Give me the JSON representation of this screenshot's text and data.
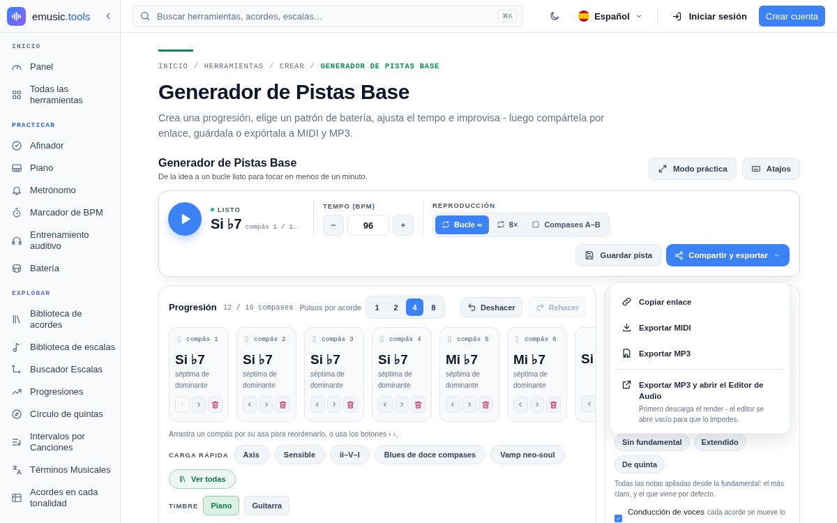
{
  "brand": {
    "name": "emusic",
    "accent": ".tools"
  },
  "search": {
    "placeholder": "Buscar herramientas, acordes, escalas…",
    "shortcut": "⌘K"
  },
  "header": {
    "language": "Español",
    "login": "Iniciar sesión",
    "signup": "Crear cuenta"
  },
  "sidebar": {
    "sections": [
      {
        "title": "INICIO",
        "color": "#64748b",
        "items": [
          {
            "label": "Panel"
          },
          {
            "label": "Todas las herramientas"
          }
        ]
      },
      {
        "title": "PRACTICAR",
        "color": "#2563eb",
        "items": [
          {
            "label": "Afinador"
          },
          {
            "label": "Piano"
          },
          {
            "label": "Metrónomo"
          },
          {
            "label": "Marcador de BPM"
          },
          {
            "label": "Entrenamiento auditivo"
          },
          {
            "label": "Batería"
          }
        ]
      },
      {
        "title": "EXPLORAR",
        "color": "#6366f1",
        "items": [
          {
            "label": "Biblioteca de acordes"
          },
          {
            "label": "Biblioteca de escalas"
          },
          {
            "label": "Buscador Escalas"
          },
          {
            "label": "Progresiones"
          },
          {
            "label": "Círculo de quintas"
          },
          {
            "label": "Intervalos por Canciones"
          },
          {
            "label": "Términos Musicales"
          },
          {
            "label": "Acordes en cada tonalidad"
          }
        ]
      }
    ]
  },
  "breadcrumbs": [
    {
      "label": "INICIO",
      "current": false
    },
    {
      "separator": "/",
      "label": "HERRAMIENTAS",
      "current": false
    },
    {
      "separator": "/",
      "label": "CREAR",
      "current": false
    },
    {
      "separator": "/",
      "label": "GENERADOR DE PISTAS BASE",
      "current": true
    }
  ],
  "title": "Generador de Pistas Base",
  "description": "Crea una progresión, elige un patrón de batería, ajusta el tempo e improvisa - luego compártela por enlace, guárdala o expórtala a MIDI y MP3.",
  "tool": {
    "title": "Generador de Pistas Base",
    "subtitle": "De la idea a un bucle listo para tocar en menos de un minuto.",
    "actions": [
      "Modo práctica",
      "Atajos"
    ]
  },
  "player": {
    "status": "LISTO",
    "chord": "Si ♭7",
    "position": "compás 1 / 1…",
    "tempo_label": "TEMPO (BPM)",
    "tempo": "96",
    "playback_label": "REPRODUCCIÓN",
    "modes": [
      {
        "label": "Bucle ∞",
        "selected": true
      },
      {
        "label": "8×",
        "selected": false
      },
      {
        "label": "Compases A–B",
        "selected": false
      }
    ],
    "save": "Guardar pista",
    "share": "Compartir y exportar"
  },
  "progression": {
    "title": "Progresión",
    "count": "12 / 16 compases",
    "beats_label": "Pulsos por acorde",
    "beats": [
      {
        "label": "1",
        "selected": false
      },
      {
        "label": "2",
        "selected": false
      },
      {
        "label": "4",
        "selected": true
      },
      {
        "label": "8",
        "selected": false
      }
    ],
    "undo": {
      "label": "Deshacer",
      "disabled": false
    },
    "redo": {
      "label": "Rehacer",
      "disabled": true
    },
    "bars": [
      {
        "label": "compás 1",
        "chord": "Si ♭7",
        "quality": "séptima de dominante",
        "prev_disabled": true
      },
      {
        "label": "compás 2",
        "chord": "Si ♭7",
        "quality": "séptima de dominante",
        "prev_disabled": false
      },
      {
        "label": "compás 3",
        "chord": "Si ♭7",
        "quality": "séptima de dominante",
        "prev_disabled": false
      },
      {
        "label": "compás 4",
        "chord": "Si ♭7",
        "quality": "séptima de dominante",
        "prev_disabled": false
      },
      {
        "label": "compás 5",
        "chord": "Mi ♭7",
        "quality": "séptima de dominante",
        "prev_disabled": false
      },
      {
        "label": "compás 6",
        "chord": "Mi ♭7",
        "quality": "séptima de dominante",
        "prev_disabled": false
      },
      {
        "chord": "Si"
      }
    ],
    "hint": "Arrastra un compás por su asa para reordenarlo, o usa los botones ‹ ›.",
    "quick_label": "CARGA RÁPIDA",
    "presets": [
      "Axis",
      "Sensible",
      "ii–V–I",
      "Blues de doce compases",
      "Vamp neo-soul"
    ],
    "view_all": "Ver todas",
    "timbre_label": "TIMBRE",
    "timbres": [
      {
        "label": "Piano",
        "selected": true
      },
      {
        "label": "Guitarra",
        "selected": false
      }
    ]
  },
  "voicing": {
    "options": [
      {
        "label": "Sin fundamental",
        "selected": false
      },
      {
        "label": "Extendido",
        "selected": false
      },
      {
        "label": "De quinta",
        "selected": false
      }
    ],
    "note": "Todas las notas apiladas desde la fundamental: el más claro, y el que viene por defecto.",
    "voice_leading": {
      "label": "Conducción de voces",
      "hint": "cada acorde se mueve lo",
      "checked": true
    }
  },
  "share_menu": {
    "items": [
      {
        "label": "Copiar enlace"
      },
      {
        "label": "Exportar MIDI"
      },
      {
        "label": "Exportar MP3"
      }
    ],
    "editor": {
      "label": "Exportar MP3 y abrir el Editor de Audio",
      "description": "Primero descarga el render - el editor se abre vacío para que lo importes."
    }
  }
}
